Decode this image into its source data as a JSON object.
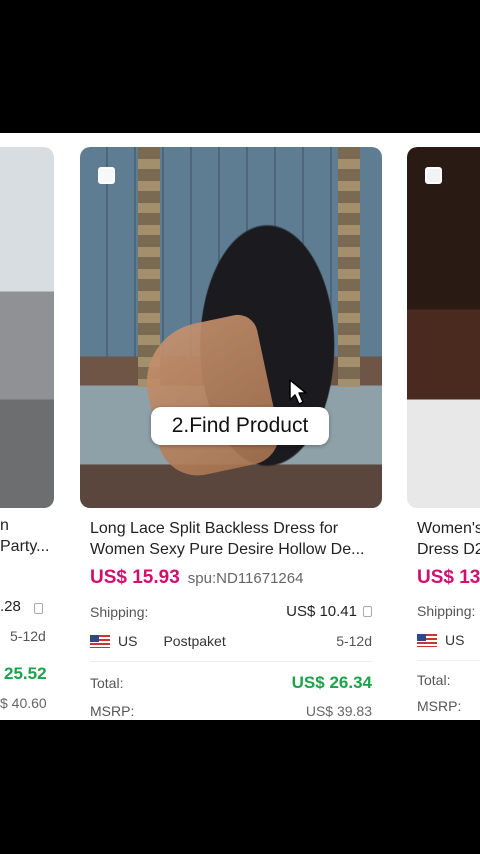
{
  "overlay_label": "2.Find Product",
  "left_card": {
    "title_tail_1": "n",
    "title_tail_2": "Party...",
    "shipping_tail": ".28",
    "days": "5-12d",
    "total": "25.52",
    "msrp": "$ 40.60"
  },
  "center_card": {
    "title": "Long Lace Split Backless Dress for Women Sexy Pure Desire Hollow De...",
    "price": "US$ 15.93",
    "spu": "spu:ND11671264",
    "shipping_label": "Shipping:",
    "shipping_value": "US$ 10.41",
    "country": "US",
    "carrier": "Postpaket",
    "days": "5-12d",
    "total_label": "Total:",
    "total_value": "US$ 26.34",
    "msrp_label": "MSRP:",
    "msrp_value": "US$ 39.83"
  },
  "right_card": {
    "title_1": "Women's",
    "title_2": "Dress D2",
    "price": "US$ 13",
    "shipping_label": "Shipping:",
    "country": "US",
    "total_label": "Total:",
    "msrp_label": "MSRP:"
  },
  "colors": {
    "price": "#d0106e",
    "total": "#1aa34a"
  }
}
